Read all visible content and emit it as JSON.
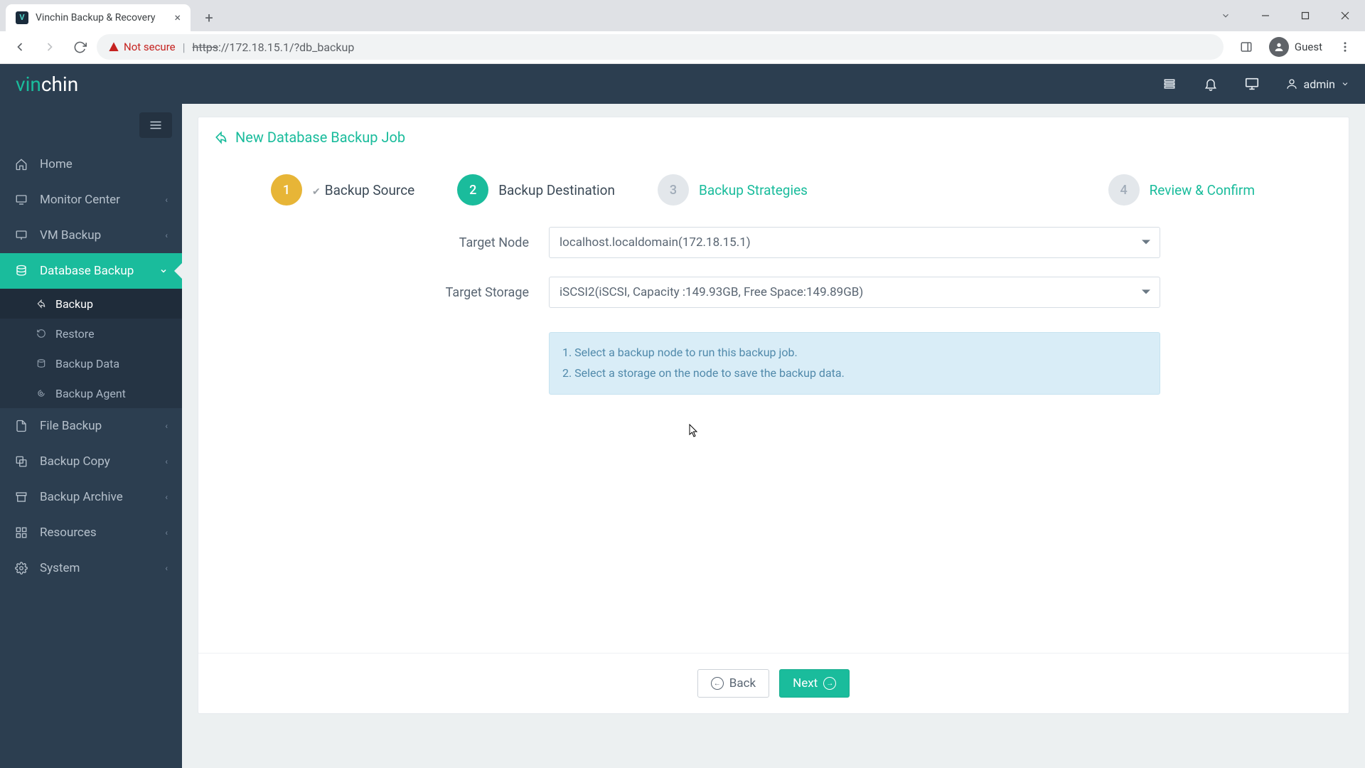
{
  "browser": {
    "tab_title": "Vinchin Backup & Recovery",
    "insecure_label": "Not secure",
    "url_prefix": "https",
    "url_rest": "://172.18.15.1/?db_backup",
    "guest_label": "Guest"
  },
  "header": {
    "logo_text_a": "vin",
    "logo_text_b": "chin",
    "user": "admin"
  },
  "sidebar": {
    "items": [
      {
        "label": "Home",
        "expandable": false
      },
      {
        "label": "Monitor Center",
        "expandable": true
      },
      {
        "label": "VM Backup",
        "expandable": true
      },
      {
        "label": "Database Backup",
        "expandable": true,
        "active": true
      },
      {
        "label": "File Backup",
        "expandable": true
      },
      {
        "label": "Backup Copy",
        "expandable": true
      },
      {
        "label": "Backup Archive",
        "expandable": true
      },
      {
        "label": "Resources",
        "expandable": true
      },
      {
        "label": "System",
        "expandable": true
      }
    ],
    "sub_items": [
      {
        "label": "Backup",
        "selected": true
      },
      {
        "label": "Restore"
      },
      {
        "label": "Backup Data"
      },
      {
        "label": "Backup Agent"
      }
    ]
  },
  "page": {
    "title": "New Database Backup Job",
    "steps": [
      {
        "num": "1",
        "label": "Backup Source",
        "state": "done"
      },
      {
        "num": "2",
        "label": "Backup Destination",
        "state": "active"
      },
      {
        "num": "3",
        "label": "Backup Strategies",
        "state": "upcoming"
      },
      {
        "num": "4",
        "label": "Review & Confirm",
        "state": "upcoming"
      }
    ],
    "form": {
      "target_node_label": "Target Node",
      "target_node_value": "localhost.localdomain(172.18.15.1)",
      "target_storage_label": "Target Storage",
      "target_storage_value": "iSCSI2(iSCSI, Capacity :149.93GB, Free Space:149.89GB)"
    },
    "info": {
      "line1": "1. Select a backup node to run this backup job.",
      "line2": "2. Select a storage on the node to save the backup data."
    },
    "footer": {
      "back": "Back",
      "next": "Next"
    }
  }
}
